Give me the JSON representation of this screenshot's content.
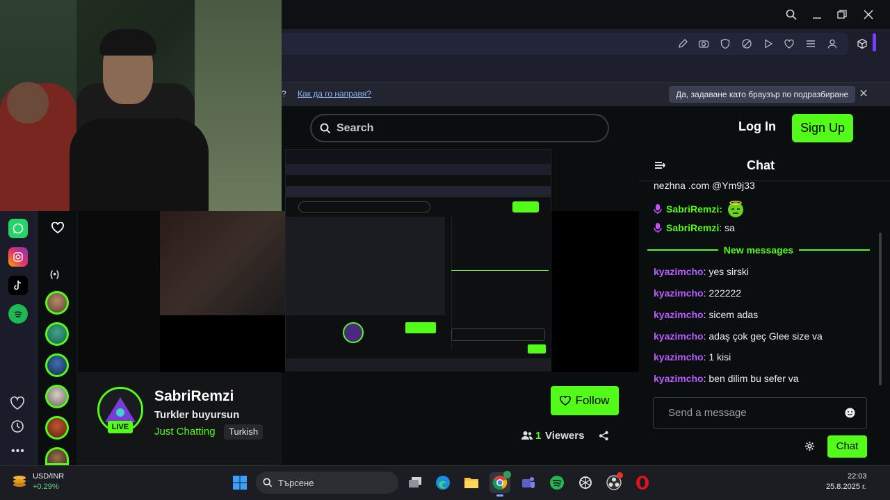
{
  "browser": {
    "info_link": "Как да го направя?",
    "info_question_mark": "?",
    "info_button": "Да, задаване като браузър по подразбиране"
  },
  "header": {
    "search_placeholder": "Search",
    "login": "Log In",
    "signup": "Sign Up"
  },
  "chat": {
    "title": "Chat",
    "messages_top": [
      {
        "text": "nezhna .com @Ym9j33"
      },
      {
        "user": "SabriRemzi",
        "text": ":"
      },
      {
        "user": "SabriRemzi",
        "text": ": sa"
      }
    ],
    "new_messages_label": "New messages",
    "messages": [
      {
        "user": "kyazimcho",
        "text": ": yes sirski"
      },
      {
        "user": "kyazimcho",
        "text": ": 222222"
      },
      {
        "user": "kyazimcho",
        "text": ": sicem adas"
      },
      {
        "user": "kyazimcho",
        "text": ": adaş çok geç Glee size va"
      },
      {
        "user": "kyazimcho",
        "text": ": 1 kisi"
      },
      {
        "user": "kyazimcho",
        "text": ": ben dilim bu sefer va"
      }
    ],
    "send_placeholder": "Send a message",
    "chat_button": "Chat"
  },
  "stream": {
    "streamer": "SabriRemzi",
    "title": "Turkler buyursun",
    "category": "Just Chatting",
    "language_tag": "Turkish",
    "live_badge": "LIVE",
    "follow": "Follow",
    "viewers_count": "1",
    "viewers_label": "Viewers"
  },
  "taskbar": {
    "ticker": "USD/INR",
    "ticker_change": "+0.29%",
    "search_placeholder": "Търсене",
    "time": "22:03",
    "date": "25.8.2025 г."
  },
  "colors": {
    "brand": "#53fc18",
    "user_color": "#b75cff",
    "background": "#0b0e0f"
  }
}
